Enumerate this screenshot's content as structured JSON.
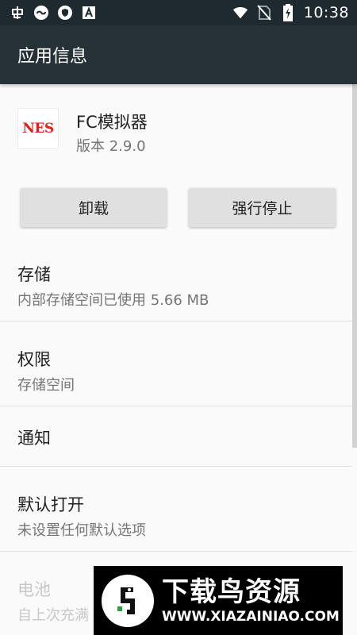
{
  "status_bar": {
    "time": "10:38",
    "left_icons": [
      "bug-icon",
      "cloud-icon",
      "shield-icon",
      "a-box-icon"
    ],
    "right_icons": [
      "wifi-icon",
      "no-sim-icon",
      "battery-charging-icon"
    ]
  },
  "app_bar": {
    "title": "应用信息"
  },
  "app": {
    "icon_text": "NES",
    "name": "FC模拟器",
    "version": "版本 2.9.0"
  },
  "buttons": {
    "uninstall": "卸载",
    "force_stop": "强行停止"
  },
  "items": [
    {
      "title": "存储",
      "subtitle": "内部存储空间已使用 5.66 MB"
    },
    {
      "title": "权限",
      "subtitle": "存储空间"
    },
    {
      "title": "通知"
    },
    {
      "title": "默认打开",
      "subtitle": "未设置任何默认选项"
    },
    {
      "title": "电池",
      "subtitle": "自上次充满"
    }
  ],
  "watermark": {
    "title": "下载鸟资源",
    "url": "WWW.XIAZAINIAO.COM"
  },
  "colors": {
    "status_bar": "#1f2a30",
    "app_bar": "#263238",
    "background": "#fafafa",
    "button": "#e0e0e0",
    "nes_red": "#e0201d"
  }
}
